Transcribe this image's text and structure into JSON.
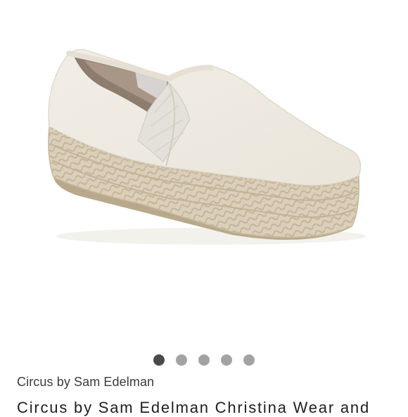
{
  "product": {
    "image_alt": "shoe-image",
    "brand": "Circus by Sam Edelman",
    "title_partial": "Circus by Sam Edelman Christina Wear and"
  },
  "carousel": {
    "total": 5,
    "active_index": 0
  },
  "colors": {
    "dot_active": "#4a4a4a",
    "dot_inactive": "#a3a3a3",
    "canvas": "#f2eee6",
    "jute": "#d8ccb6"
  }
}
